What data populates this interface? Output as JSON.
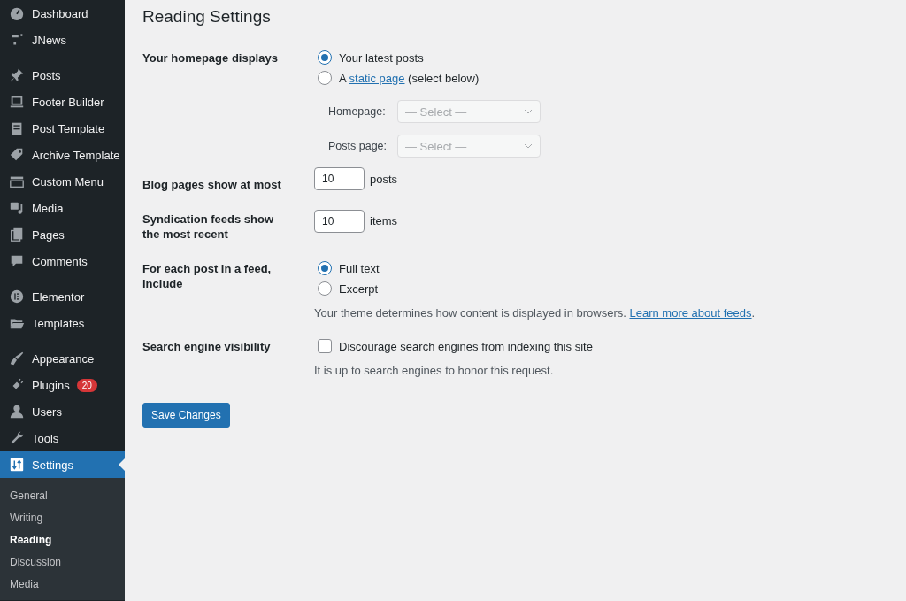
{
  "sidebar": {
    "groups": [
      {
        "items": [
          {
            "label": "Dashboard",
            "selected": false
          },
          {
            "label": "JNews",
            "selected": false
          }
        ]
      },
      {
        "items": [
          {
            "label": "Posts",
            "selected": false
          },
          {
            "label": "Footer Builder",
            "selected": false
          },
          {
            "label": "Post Template",
            "selected": false
          },
          {
            "label": "Archive Template",
            "selected": false
          },
          {
            "label": "Custom Menu",
            "selected": false
          },
          {
            "label": "Media",
            "selected": false
          },
          {
            "label": "Pages",
            "selected": false
          },
          {
            "label": "Comments",
            "selected": false
          }
        ]
      },
      {
        "items": [
          {
            "label": "Elementor",
            "selected": false
          },
          {
            "label": "Templates",
            "selected": false
          }
        ]
      },
      {
        "items": [
          {
            "label": "Appearance",
            "selected": false
          },
          {
            "label": "Plugins",
            "selected": false,
            "badge": "20"
          },
          {
            "label": "Users",
            "selected": false
          },
          {
            "label": "Tools",
            "selected": false
          },
          {
            "label": "Settings",
            "selected": true
          }
        ]
      }
    ],
    "submenu": [
      {
        "label": "General",
        "selected": false
      },
      {
        "label": "Writing",
        "selected": false
      },
      {
        "label": "Reading",
        "selected": true
      },
      {
        "label": "Discussion",
        "selected": false
      },
      {
        "label": "Media",
        "selected": false
      }
    ]
  },
  "page": {
    "title": "Reading Settings",
    "rows": [
      {
        "kind": "radio",
        "label": "Your homepage displays",
        "options": [
          {
            "text": "Your latest posts",
            "selected": true
          },
          {
            "prefix": "A",
            "link": "static page",
            "suffix": "(select below)",
            "selected": false
          }
        ],
        "selects": [
          {
            "label": "Homepage:",
            "placeholder": "— Select —",
            "disabled": true
          },
          {
            "label": "Posts page:",
            "placeholder": "— Select —",
            "disabled": true
          }
        ]
      },
      {
        "kind": "number",
        "label": "Blog pages show at most",
        "value": "10",
        "unit": "posts"
      },
      {
        "kind": "number",
        "label": "Syndication feeds show the most recent",
        "value": "10",
        "unit": "items"
      },
      {
        "kind": "radio",
        "label": "For each post in a feed, include",
        "options": [
          {
            "text": "Full text",
            "selected": true
          },
          {
            "text": "Excerpt",
            "selected": false
          }
        ],
        "note": {
          "text": "Your theme determines how content is displayed in browsers.",
          "link": "Learn more about feeds",
          "end": "."
        }
      },
      {
        "kind": "checkbox",
        "label": "Search engine visibility",
        "text": "Discourage search engines from indexing this site",
        "checked": false,
        "note": {
          "text": "It is up to search engines to honor this request."
        }
      }
    ],
    "save_button": "Save Changes"
  }
}
